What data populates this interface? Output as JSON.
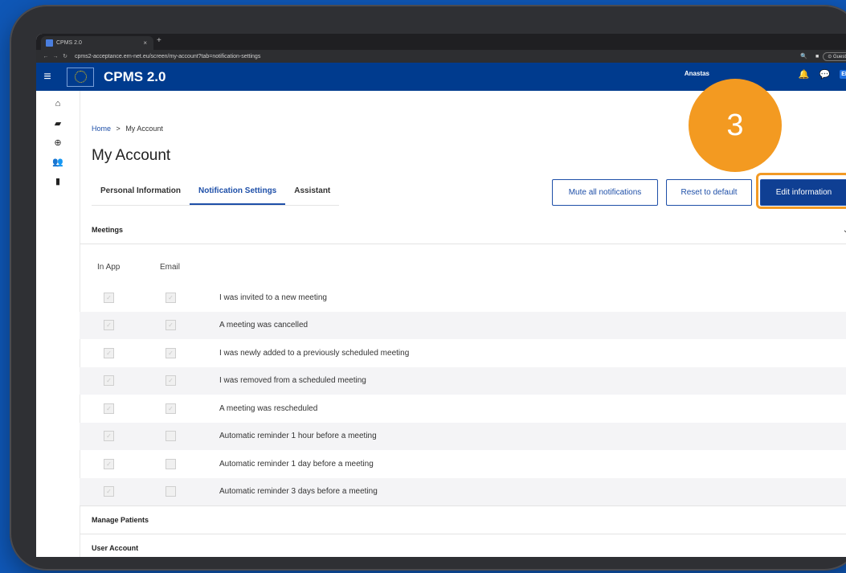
{
  "browser": {
    "tab_title": "CPMS 2.0",
    "tab_close": "×",
    "new_tab": "+",
    "url": "cpms2-acceptance.ern-net.eu/screen/my-account?tab=notification-settings",
    "guest_label": "Guest"
  },
  "header": {
    "title": "CPMS 2.0",
    "user_name": "Anastas",
    "language": "EN"
  },
  "breadcrumb": {
    "home": "Home",
    "separator": ">",
    "current": "My Account"
  },
  "page": {
    "title": "My Account"
  },
  "tabs": [
    {
      "label": "Personal Information"
    },
    {
      "label": "Notification Settings"
    },
    {
      "label": "Assistant"
    }
  ],
  "actions": {
    "mute_all": "Mute all notifications",
    "reset": "Reset to default",
    "edit": "Edit information"
  },
  "step_badge": "3",
  "sections": {
    "meetings": "Meetings",
    "manage_patients": "Manage Patients",
    "user_account": "User Account"
  },
  "columns": {
    "in_app": "In App",
    "email": "Email"
  },
  "notifications": [
    {
      "label": "I was invited to a new meeting",
      "in_app": true,
      "email": true
    },
    {
      "label": "A meeting was cancelled",
      "in_app": true,
      "email": true
    },
    {
      "label": "I was newly added to a previously scheduled meeting",
      "in_app": true,
      "email": true
    },
    {
      "label": "I was removed from a scheduled meeting",
      "in_app": true,
      "email": true
    },
    {
      "label": "A meeting was rescheduled",
      "in_app": true,
      "email": true
    },
    {
      "label": "Automatic reminder 1 hour before a meeting",
      "in_app": true,
      "email": false
    },
    {
      "label": "Automatic reminder 1 day before a meeting",
      "in_app": true,
      "email": false
    },
    {
      "label": "Automatic reminder 3 days before a meeting",
      "in_app": true,
      "email": false
    }
  ],
  "colors": {
    "background": "#0f57b6",
    "header": "#003b8e",
    "accent": "#1e4fa8",
    "badge": "#f39a21"
  }
}
